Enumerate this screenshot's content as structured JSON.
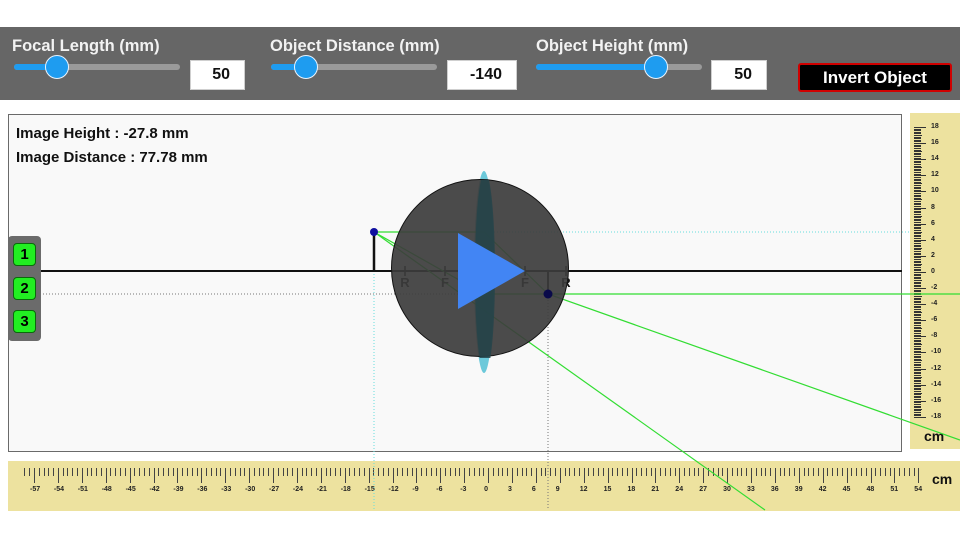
{
  "controls": {
    "focal_length": {
      "label": "Focal Length (mm)",
      "value": "50",
      "fraction": 0.26
    },
    "object_distance": {
      "label": "Object Distance (mm)",
      "value": "-140",
      "fraction": 0.21
    },
    "object_height": {
      "label": "Object Height (mm)",
      "value": "50",
      "fraction": 0.72
    },
    "invert_button": "Invert Object"
  },
  "readouts": {
    "image_height": "Image Height : -27.8 mm",
    "image_distance": "Image Distance : 77.78 mm"
  },
  "presets": [
    "1",
    "2",
    "3"
  ],
  "optics": {
    "axis_markers": [
      "R",
      "F",
      "F",
      "R"
    ],
    "lens_color": "#6cc9da",
    "ray_color": "#33dd33",
    "object_point_color": "#1010a0",
    "image_point_color": "#0a0a4a"
  },
  "vertical_ruler": {
    "unit": "cm",
    "labels": [
      "18",
      "16",
      "14",
      "12",
      "10",
      "8",
      "6",
      "4",
      "2",
      "0",
      "-2",
      "-4",
      "-6",
      "-8",
      "-10",
      "-12",
      "-14",
      "-16",
      "-18"
    ]
  },
  "horizontal_ruler": {
    "unit": "cm",
    "labels": [
      "-57",
      "-54",
      "-51",
      "-48",
      "-45",
      "-42",
      "-39",
      "-36",
      "-33",
      "-30",
      "-27",
      "-24",
      "-21",
      "-18",
      "-15",
      "-12",
      "-9",
      "-6",
      "-3",
      "0",
      "3",
      "6",
      "9",
      "12",
      "15",
      "18",
      "21",
      "24",
      "27",
      "30",
      "33",
      "36",
      "39",
      "42",
      "45",
      "48",
      "51",
      "54"
    ]
  },
  "video_overlay": {
    "icon": "play-icon",
    "color": "#4285f4"
  }
}
